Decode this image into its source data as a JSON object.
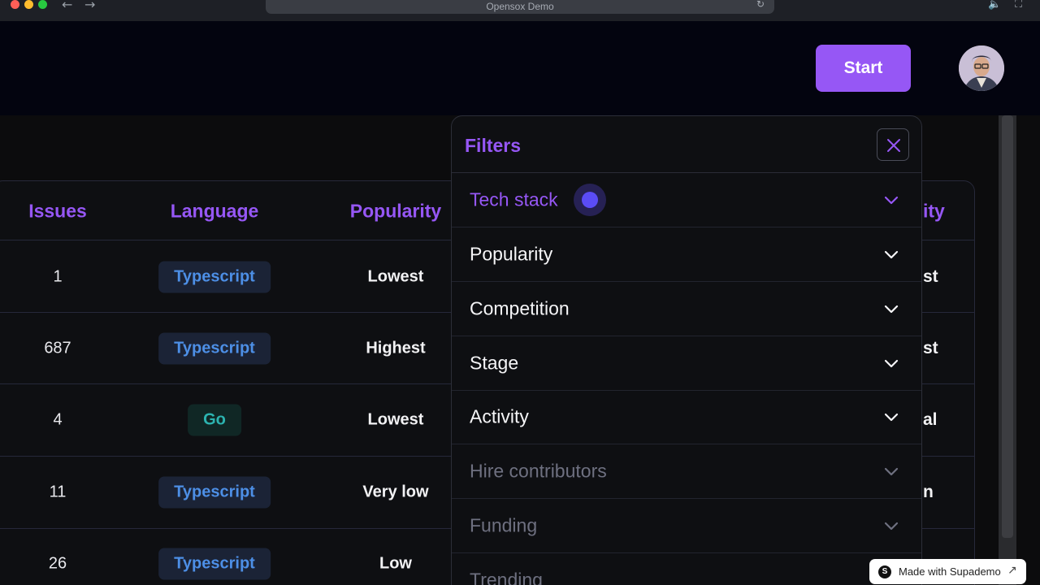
{
  "browser": {
    "url_title": "Opensox Demo",
    "back_icon": "←",
    "forward_icon": "→",
    "reload_icon": "↻",
    "speaker_icon": "🔈",
    "expand_icon": "⛶"
  },
  "header": {
    "start_label": "Start"
  },
  "table": {
    "columns": [
      "Issues",
      "Language",
      "Popularity"
    ],
    "right_column_fragment": "ity",
    "rows": [
      {
        "issues": "1",
        "language": "Typescript",
        "lang_type": "ts",
        "popularity": "Lowest",
        "right": "st"
      },
      {
        "issues": "687",
        "language": "Typescript",
        "lang_type": "ts",
        "popularity": "Highest",
        "right": "st"
      },
      {
        "issues": "4",
        "language": "Go",
        "lang_type": "go",
        "popularity": "Lowest",
        "right": "al"
      },
      {
        "issues": "11",
        "language": "Typescript",
        "lang_type": "ts",
        "popularity": "Very low",
        "right": "n"
      },
      {
        "issues": "26",
        "language": "Typescript",
        "lang_type": "ts",
        "popularity": "Low",
        "right": ""
      }
    ]
  },
  "filters": {
    "title": "Filters",
    "items": [
      {
        "label": "Tech stack",
        "state": "active"
      },
      {
        "label": "Popularity",
        "state": "normal"
      },
      {
        "label": "Competition",
        "state": "normal"
      },
      {
        "label": "Stage",
        "state": "normal"
      },
      {
        "label": "Activity",
        "state": "normal"
      },
      {
        "label": "Hire contributors",
        "state": "dim"
      },
      {
        "label": "Funding",
        "state": "dim"
      },
      {
        "label": "Trending",
        "state": "dim"
      }
    ]
  },
  "badge": {
    "logo": "S",
    "text": "Made with Supademo",
    "arrow": "↗"
  },
  "colors": {
    "accent": "#9657f5",
    "background": "#0c0c0d",
    "header_bg": "#03040f",
    "typescript_text": "#4d8fe6",
    "go_text": "#2cb3b0"
  }
}
